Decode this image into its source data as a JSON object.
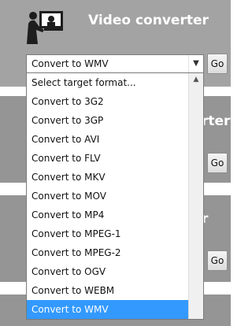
{
  "panel1": {
    "title": "Video converter",
    "go_label": "Go"
  },
  "panel2": {
    "title": "rter",
    "go_label": "Go"
  },
  "panel3": {
    "title": "r",
    "go_label": "Go"
  },
  "select": {
    "value": "Convert to WMV"
  },
  "options": [
    "Select target format...",
    "Convert to 3G2",
    "Convert to 3GP",
    "Convert to AVI",
    "Convert to FLV",
    "Convert to MKV",
    "Convert to MOV",
    "Convert to MP4",
    "Convert to MPEG-1",
    "Convert to MPEG-2",
    "Convert to OGV",
    "Convert to WEBM",
    "Convert to WMV"
  ],
  "selected_index": 12,
  "icons": {
    "logo": "person-at-tv-icon",
    "caret": "chevron-down-icon",
    "scroll_up": "scroll-up-arrow-icon"
  }
}
